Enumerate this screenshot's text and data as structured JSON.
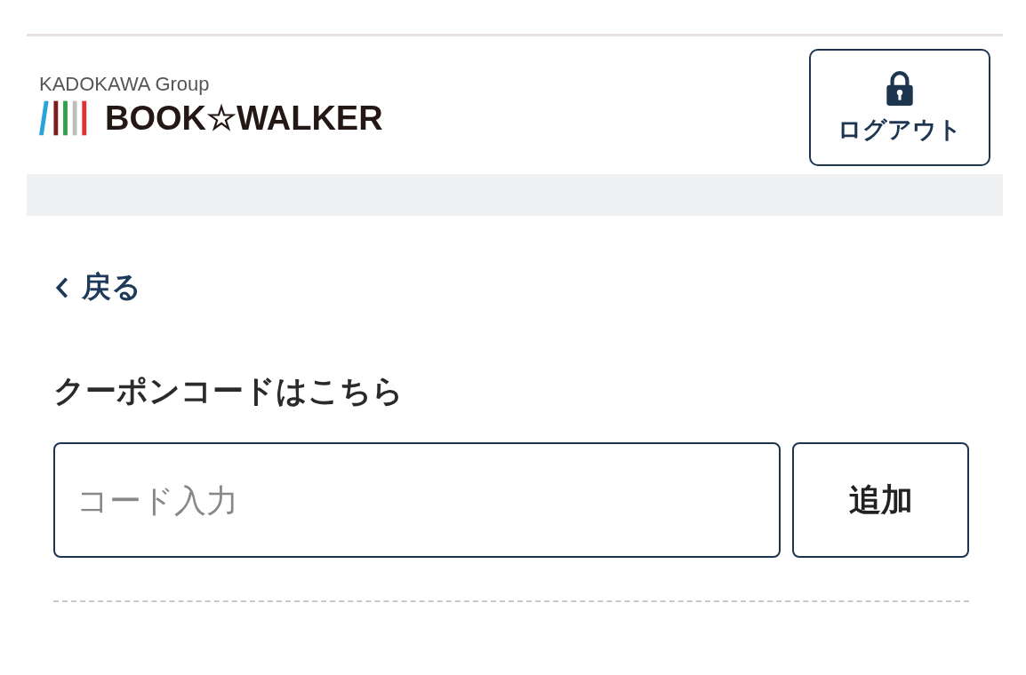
{
  "header": {
    "group_label": "KADOKAWA Group",
    "logo_text": "BOOK☆WALKER",
    "logout_button": "ログアウト"
  },
  "back_link": "戻る",
  "coupon": {
    "heading": "クーポンコードはこちら",
    "placeholder": "コード入力",
    "add_button": "追加"
  }
}
